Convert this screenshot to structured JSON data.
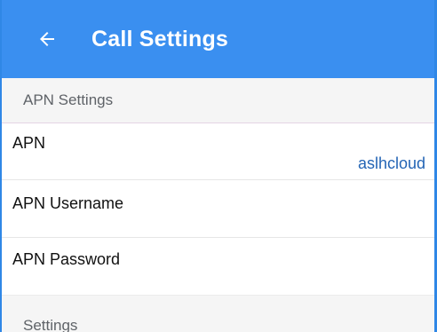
{
  "appbar": {
    "back_icon": "arrow-left-icon",
    "title": "Call Settings",
    "color": "#3a8ff0"
  },
  "sections": {
    "apn_header": "APN Settings",
    "settings_header": "Settings"
  },
  "apn_rows": {
    "apn_label": "APN",
    "apn_value": "aslhcloud",
    "username_label": "APN Username",
    "password_label": "APN Password"
  }
}
